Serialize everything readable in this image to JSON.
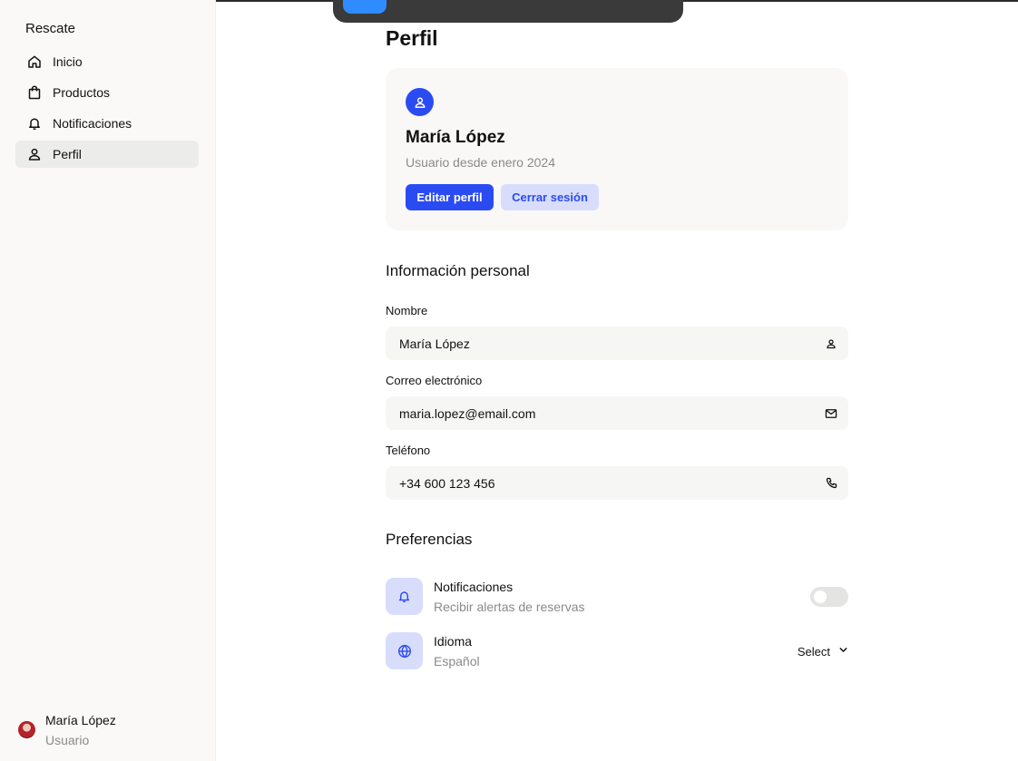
{
  "sidebar": {
    "brand": "Rescate",
    "items": [
      {
        "label": "Inicio",
        "icon": "home-icon"
      },
      {
        "label": "Productos",
        "icon": "shopping-bag-icon"
      },
      {
        "label": "Notificaciones",
        "icon": "bell-icon"
      },
      {
        "label": "Perfil",
        "icon": "user-icon",
        "active": true
      }
    ],
    "user": {
      "name": "María López",
      "role": "Usuario"
    }
  },
  "page": {
    "title": "Perfil"
  },
  "profile_card": {
    "name": "María López",
    "member_since": "Usuario desde enero 2024",
    "edit_label": "Editar perfil",
    "logout_label": "Cerrar sesión"
  },
  "personal_info": {
    "title": "Información personal",
    "fields": [
      {
        "label": "Nombre",
        "value": "María López",
        "icon": "user-icon"
      },
      {
        "label": "Correo electrónico",
        "value": "maria.lopez@email.com",
        "icon": "mail-icon"
      },
      {
        "label": "Teléfono",
        "value": "+34 600 123 456",
        "icon": "phone-icon"
      }
    ]
  },
  "preferences": {
    "title": "Preferencias",
    "notifications": {
      "title": "Notificaciones",
      "subtitle": "Recibir alertas de reservas",
      "enabled": false
    },
    "language": {
      "title": "Idioma",
      "subtitle": "Español",
      "select_label": "Select"
    }
  },
  "colors": {
    "accent": "#2b4bf2",
    "accent_soft": "#d8ddfc",
    "sidebar_bg": "#faf9f8",
    "muted_text": "#8a8a8a"
  }
}
